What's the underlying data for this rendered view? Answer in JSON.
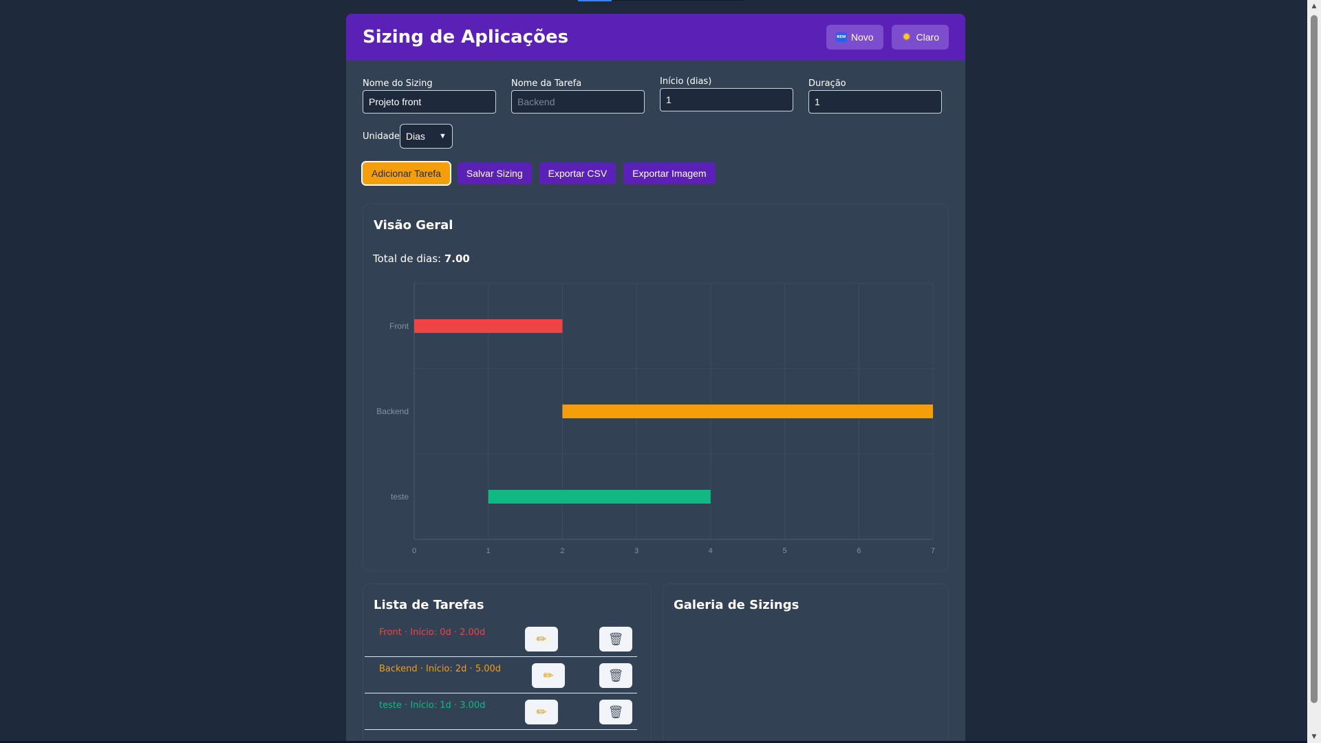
{
  "app": {
    "title": "Sizing de Aplicações",
    "header_buttons": [
      {
        "icon": "new-icon",
        "icon_text": "NEW",
        "label": "Novo"
      },
      {
        "icon": "sun-icon",
        "label": "Claro"
      }
    ]
  },
  "form": {
    "sizing_name": {
      "label": "Nome do Sizing",
      "value": "Projeto front"
    },
    "task_name": {
      "label": "Nome da Tarefa",
      "placeholder": "Backend",
      "value": ""
    },
    "start": {
      "label": "Início (dias)",
      "value": "1"
    },
    "duration": {
      "label": "Duração",
      "value": "1"
    },
    "unit": {
      "label": "Unidade",
      "selected": "Dias"
    }
  },
  "actions": {
    "add_task": "Adicionar Tarefa",
    "save_sizing": "Salvar Sizing",
    "export_csv": "Exportar CSV",
    "export_image": "Exportar Imagem"
  },
  "overview": {
    "title": "Visão Geral",
    "total_label": "Total de dias:",
    "total_value": "7.00"
  },
  "chart_data": {
    "type": "bar",
    "orientation": "horizontal-gantt",
    "categories": [
      "Front",
      "Backend",
      "teste"
    ],
    "series": [
      {
        "start": [
          0,
          2,
          1
        ],
        "end": [
          2,
          7,
          4
        ]
      }
    ],
    "colors": [
      "#ef4444",
      "#f59e0b",
      "#10b981"
    ],
    "xlim": [
      0,
      7
    ],
    "xticks": [
      0,
      1,
      2,
      3,
      4,
      5,
      6,
      7
    ],
    "grid": true
  },
  "task_list": {
    "title": "Lista de Tarefas",
    "items": [
      {
        "text": "Front · Início: 0d · 2.00d",
        "color": "#ef4444"
      },
      {
        "text": "Backend · Início: 2d · 5.00d",
        "color": "#f59e0b"
      },
      {
        "text": "teste · Início: 1d · 3.00d",
        "color": "#10b981"
      }
    ]
  },
  "gallery": {
    "title": "Galeria de Sizings"
  },
  "icons": {
    "edit": "✏",
    "delete": "🗑"
  }
}
